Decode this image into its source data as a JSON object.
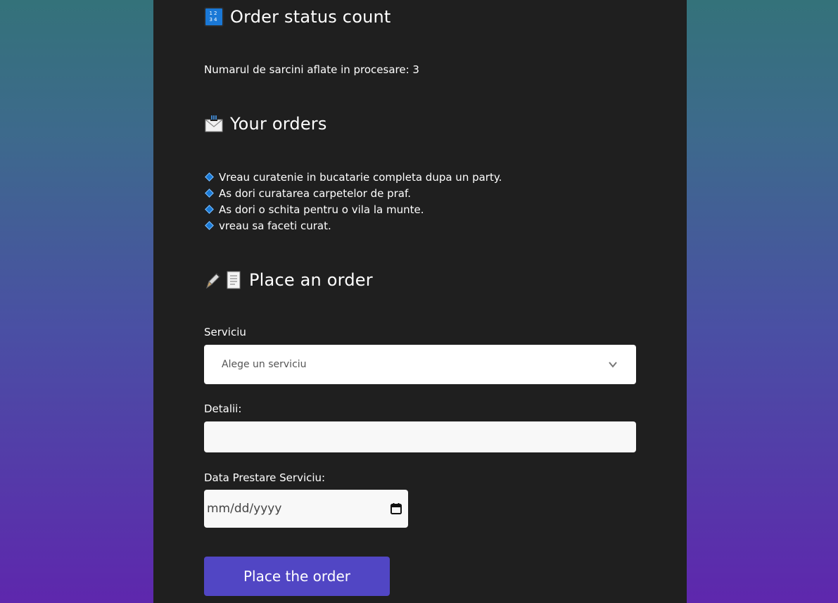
{
  "status_section": {
    "heading": "Order status count",
    "icon": "input-numbers-icon",
    "processing_text": "Numarul de sarcini aflate in procesare: 3"
  },
  "orders_section": {
    "heading": "Your orders",
    "icon": "envelope-icon",
    "orders": [
      "Vreau curatenie in bucatarie completa dupa un party.",
      "As dori curatarea carpetelor de praf.",
      "As dori o schita pentru o vila la munte.",
      "vreau sa faceti curat."
    ]
  },
  "order_form": {
    "heading": "Place an order",
    "icons": [
      "pen-icon",
      "page-icon"
    ],
    "service_label": "Serviciu",
    "service_placeholder": "Alege un serviciu",
    "details_label": "Detalii:",
    "details_value": "",
    "date_label": "Data Prestare Serviciu:",
    "date_placeholder": "mm/dd/yyyy",
    "submit_label": "Place the order"
  },
  "colors": {
    "panel_bg": "#1f1f1f",
    "button_bg": "#5146c4",
    "bullet": "#1a7ad6"
  }
}
